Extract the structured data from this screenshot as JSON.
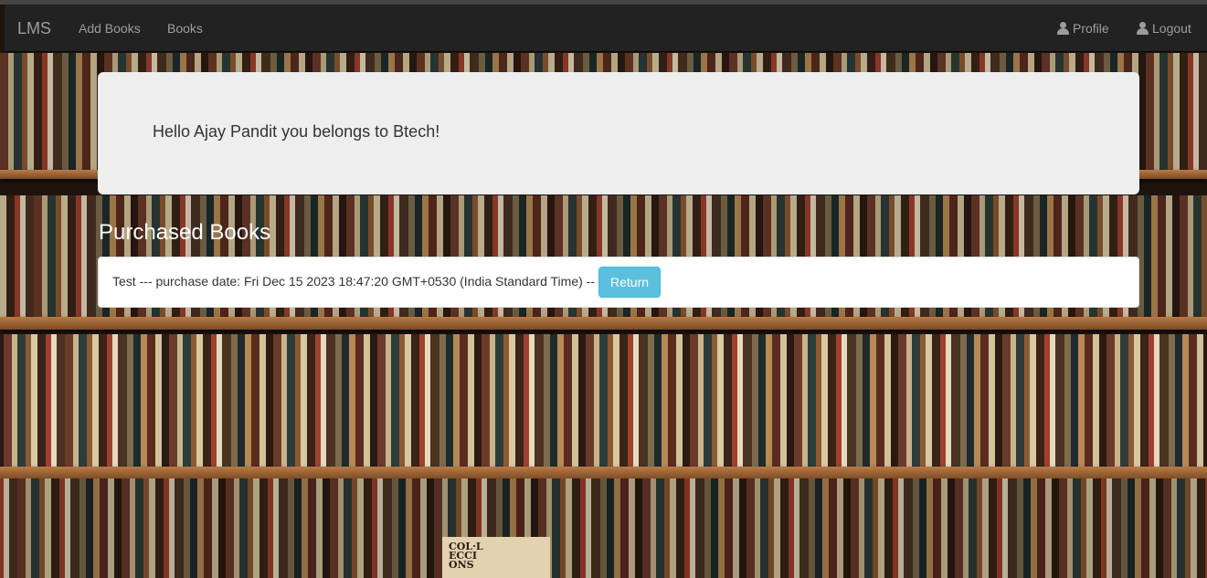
{
  "navbar": {
    "brand": "LMS",
    "links": [
      "Add Books",
      "Books"
    ],
    "profile_label": "Profile",
    "logout_label": "Logout",
    "icons": {
      "profile": "user-icon",
      "logout": "user-icon"
    }
  },
  "jumbotron": {
    "greeting": "Hello Ajay Pandit you belongs to Btech!"
  },
  "purchased": {
    "title": "Purchased Books",
    "items": [
      {
        "text": "Test --- purchase date: Fri Dec 15 2023 18:47:20 GMT+0530 (India Standard Time) --",
        "button_label": "Return"
      }
    ]
  },
  "background": {
    "book_spine_text": [
      "COL·L",
      "ECCI",
      "ONS"
    ]
  },
  "colors": {
    "navbar_bg": "#222222",
    "nav_text": "#9d9d9d",
    "jumbotron_bg": "#eeeeee",
    "return_button": "#5bc0de"
  }
}
